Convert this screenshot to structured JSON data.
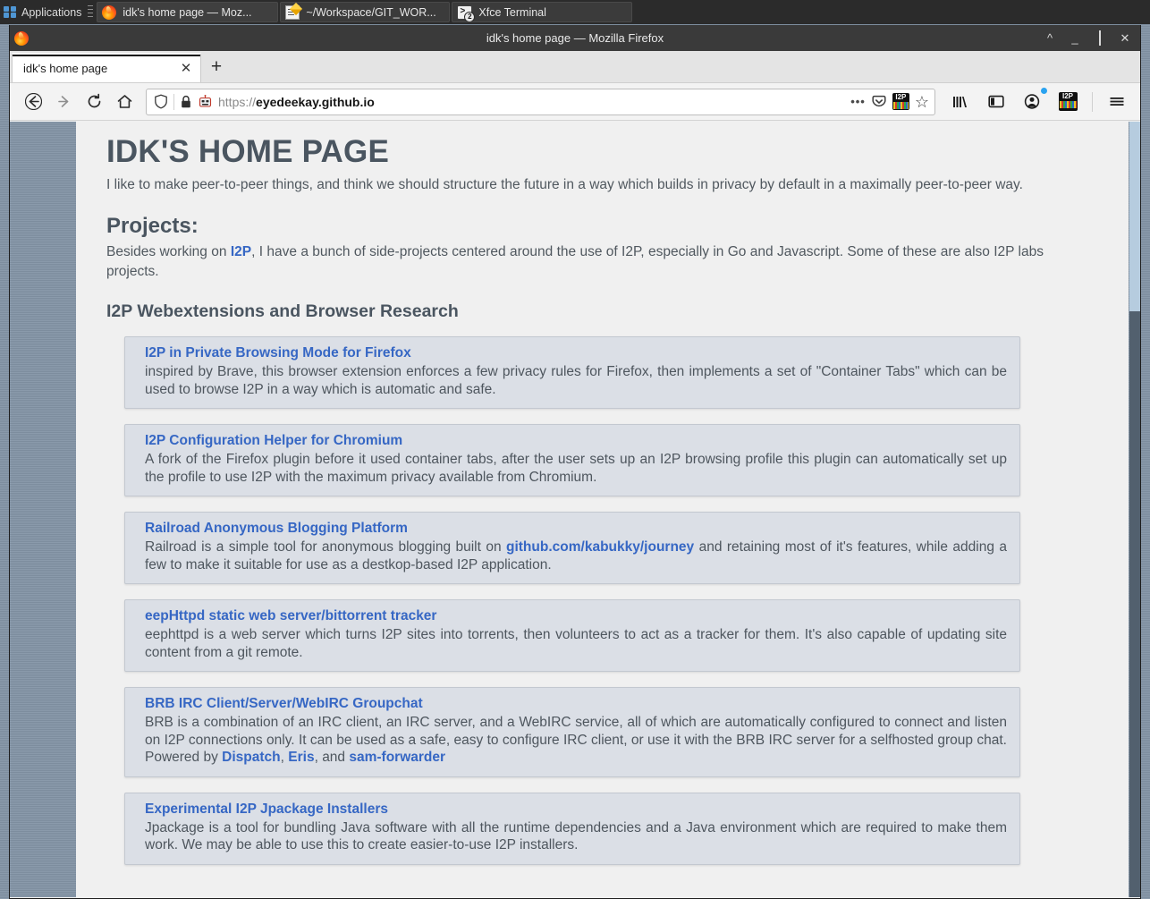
{
  "panel": {
    "applications_label": "Applications",
    "tasks": [
      {
        "label": "idk's home page — Moz...",
        "icon": "firefox-icon",
        "active": true
      },
      {
        "label": "~/Workspace/GIT_WOR...",
        "icon": "text-editor-icon",
        "active": false
      },
      {
        "label": "Xfce Terminal",
        "icon": "terminal-icon",
        "badge": "2",
        "active": false
      }
    ]
  },
  "window": {
    "title": "idk's home page — Mozilla Firefox",
    "controls": {
      "shade": "^",
      "minimize": "_",
      "maximize": "□",
      "close": "✕"
    }
  },
  "tabs": {
    "items": [
      {
        "title": "idk's home page",
        "close": "✕"
      }
    ],
    "new_tab": "+"
  },
  "navbar": {
    "back": "←",
    "forward": "→",
    "reload": "⟳",
    "home": "⌂",
    "url_scheme": "https://",
    "url_host": "eyedeekay.github.io",
    "page_actions": "•••",
    "save_to_pocket": "pocket-icon",
    "i2p_in_url": "I2P",
    "bookmark": "☆",
    "library": "library-icon",
    "sidebar": "sidebar-icon",
    "account": "account-icon",
    "i2p_extension": "I2P",
    "menu": "☰"
  },
  "page": {
    "title": "IDK'S HOME PAGE",
    "lede": "I like to make peer-to-peer things, and think we should structure the future in a way which builds in privacy by default in a maximally peer-to-peer way.",
    "projects_heading": "Projects:",
    "projects_intro_pre": "Besides working on ",
    "projects_intro_link": "I2P",
    "projects_intro_post": ", I have a bunch of side-projects centered around the use of I2P, especially in Go and Javascript. Some of these are also I2P labs projects.",
    "subsection_heading": "I2P Webextensions and Browser Research",
    "cards": [
      {
        "title": "I2P in Private Browsing Mode for Firefox",
        "body": "inspired by Brave, this browser extension enforces a few privacy rules for Firefox, then implements a set of \"Container Tabs\" which can be used to browse I2P in a way which is automatic and safe."
      },
      {
        "title": "I2P Configuration Helper for Chromium",
        "body": "A fork of the Firefox plugin before it used container tabs, after the user sets up an I2P browsing profile this plugin can automatically set up the profile to use I2P with the maximum privacy available from Chromium."
      },
      {
        "title": "Railroad Anonymous Blogging Platform",
        "body_pre": "Railroad is a simple tool for anonymous blogging built on ",
        "body_link": "github.com/kabukky/journey",
        "body_post": " and retaining most of it's features, while adding a few to make it suitable for use as a destkop-based I2P application."
      },
      {
        "title": "eepHttpd static web server/bittorrent tracker",
        "body": "eephttpd is a web server which turns I2P sites into torrents, then volunteers to act as a tracker for them. It's also capable of updating site content from a git remote."
      },
      {
        "title": "BRB IRC Client/Server/WebIRC Groupchat",
        "body_pre": "BRB is a combination of an IRC client, an IRC server, and a WebIRC service, all of which are automatically configured to connect and listen on I2P connections only. It can be used as a safe, easy to configure IRC client, or use it with the BRB IRC server for a selfhosted group chat. Powered by ",
        "body_link1": "Dispatch",
        "body_mid1": ", ",
        "body_link2": "Eris",
        "body_mid2": ", and ",
        "body_link3": "sam-forwarder"
      },
      {
        "title": "Experimental I2P Jpackage Installers",
        "body": "Jpackage is a tool for bundling Java software with all the runtime dependencies and a Java environment which are required to make them work. We may be able to use this to create easier-to-use I2P installers."
      }
    ]
  },
  "colors": {
    "link": "#3667c4",
    "heading": "#4a5560",
    "card_bg": "#dbdfe6",
    "panel_bg": "#2b2b2b",
    "titlebar_bg": "#3a3a3a"
  }
}
